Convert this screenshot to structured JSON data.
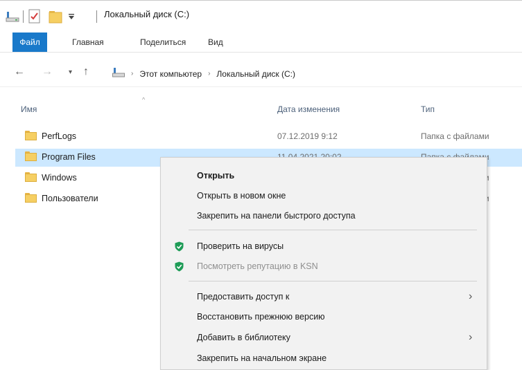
{
  "title_bar": {
    "title": "Локальный диск (C:)",
    "quick_access_icons": [
      "drive-icon",
      "properties-check-icon",
      "new-folder-icon",
      "customize-dropdown-icon"
    ]
  },
  "ribbon": {
    "tabs": [
      "Файл",
      "Главная",
      "Поделиться",
      "Вид"
    ],
    "active_tab": "Файл"
  },
  "address_bar": {
    "crumbs": [
      "Этот компьютер",
      "Локальный диск (C:)"
    ]
  },
  "columns": {
    "name": "Имя",
    "date": "Дата изменения",
    "type": "Тип"
  },
  "files": [
    {
      "name": "PerfLogs",
      "date": "07.12.2019 9:12",
      "type": "Папка с файлами"
    },
    {
      "name": "Program Files",
      "date": "11.04.2021 20:02",
      "type": "Папка с файлами"
    },
    {
      "name": "Windows",
      "date": "",
      "type": "Папка с файлами"
    },
    {
      "name": "Пользователи",
      "date": "",
      "type": "Папка с файлами"
    }
  ],
  "context_menu": {
    "items": [
      {
        "label": "Открыть",
        "bold": true
      },
      {
        "label": "Открыть в новом окне"
      },
      {
        "label": "Закрепить на панели быстрого доступа"
      },
      {
        "label": "Проверить на вирусы",
        "icon": "kaspersky-shield-icon"
      },
      {
        "label": "Посмотреть репутацию в KSN",
        "icon": "kaspersky-shield-icon",
        "disabled": true
      },
      {
        "label": "Предоставить доступ к",
        "submenu": true
      },
      {
        "label": "Восстановить прежнюю версию"
      },
      {
        "label": "Добавить в библиотеку",
        "submenu": true
      },
      {
        "label": "Закрепить на начальном экране"
      }
    ]
  },
  "colors": {
    "file_tab": "#1979ca",
    "selection": "#cce8ff",
    "folder": "#f6cf63",
    "shield": "#1e9c57",
    "menu_bg": "#f2f2f2"
  }
}
